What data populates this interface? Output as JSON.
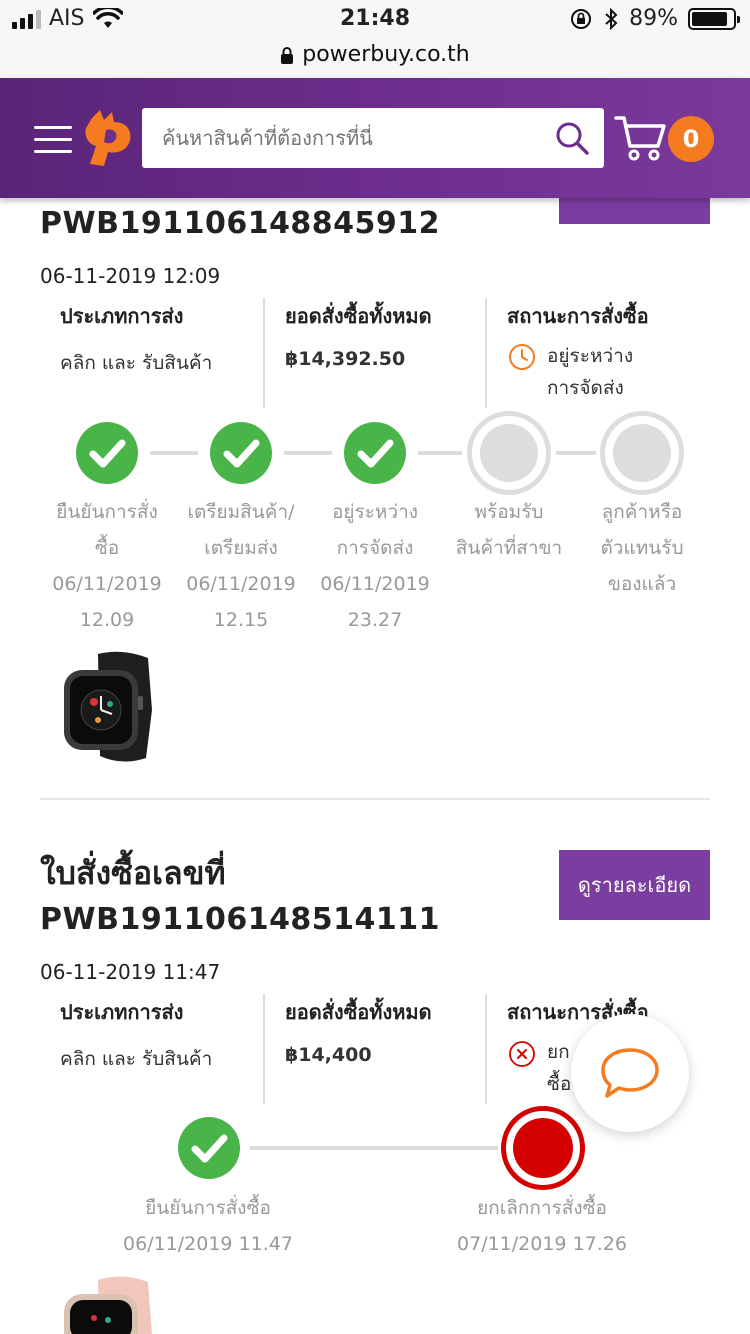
{
  "status_bar": {
    "carrier": "AIS",
    "time": "21:48",
    "battery": "89%"
  },
  "url": "powerbuy.co.th",
  "header": {
    "search_placeholder": "ค้นหาสินค้าที่ต้องการที่นี่",
    "cart_count": "0"
  },
  "orders": [
    {
      "number": "PWB191106148845912",
      "date": "06-11-2019 12:09",
      "delivery_type_label": "ประเภทการส่ง",
      "delivery_type": "คลิก และ รับสินค้า",
      "total_label": "ยอดสั่งซื้อทั้งหมด",
      "total": "฿14,392.50",
      "status_label": "สถานะการสั่งซื้อ",
      "status_line1": "อยู่ระหว่าง",
      "status_line2": "การจัดส่ง",
      "steps": [
        {
          "line1": "ยืนยันการสั่ง",
          "line2": "ซื้อ",
          "date": "06/11/2019",
          "time": "12.09",
          "state": "done"
        },
        {
          "line1": "เตรียมสินค้า/",
          "line2": "เตรียมส่ง",
          "date": "06/11/2019",
          "time": "12.15",
          "state": "done"
        },
        {
          "line1": "อยู่ระหว่าง",
          "line2": "การจัดส่ง",
          "date": "06/11/2019",
          "time": "23.27",
          "state": "done"
        },
        {
          "line1": "พร้อมรับ",
          "line2": "สินค้าที่สาขา",
          "date": "",
          "time": "",
          "state": "pending"
        },
        {
          "line1": "ลูกค้าหรือ",
          "line2": "ตัวแทนรับ",
          "line3": "ของแล้ว",
          "state": "pending"
        }
      ]
    },
    {
      "title": "ใบสั่งซื้อเลขที่",
      "number": "PWB191106148514111",
      "detail_button": "ดูรายละเอียด",
      "date": "06-11-2019 11:47",
      "delivery_type_label": "ประเภทการส่ง",
      "delivery_type": "คลิก และ รับสินค้า",
      "total_label": "ยอดสั่งซื้อทั้งหมด",
      "total": "฿14,400",
      "status_label": "สถานะการสั่งซื้อ",
      "status_line1": "ยก",
      "status_line2": "ซื้อ",
      "steps": [
        {
          "label": "ยืนยันการสั่งซื้อ",
          "datetime": "06/11/2019 11.47",
          "state": "done"
        },
        {
          "label": "ยกเลิกการสั่งซื้อ",
          "datetime": "07/11/2019 17.26",
          "state": "cancelled"
        }
      ]
    }
  ],
  "colors": {
    "brand_purple": "#6c2d8c",
    "orange": "#f47b20",
    "success": "#49b549",
    "cancel": "#d50000"
  }
}
